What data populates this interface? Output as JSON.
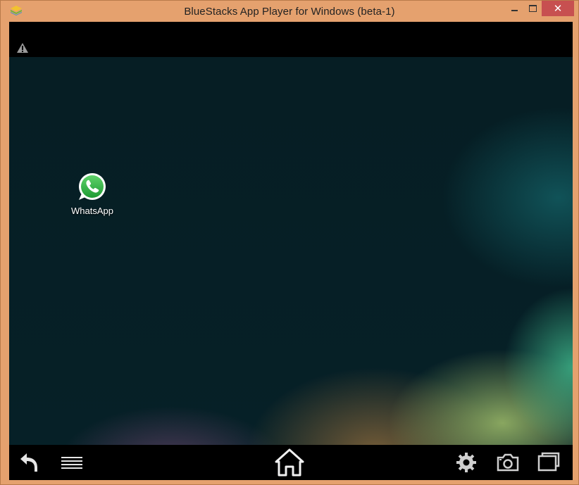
{
  "window": {
    "title": "BlueStacks App Player for Windows (beta-1)",
    "buttons": {
      "minimize": "minimize",
      "maximize": "maximize",
      "close": "✕"
    }
  },
  "statusbar": {
    "warning_icon": "warning-icon"
  },
  "home": {
    "apps": [
      {
        "label": "WhatsApp",
        "icon": "whatsapp-icon"
      }
    ]
  },
  "navbar": {
    "icons": [
      "back-icon",
      "menu-icon",
      "home-icon",
      "settings-icon",
      "camera-icon",
      "fullscreen-icon"
    ]
  },
  "colors": {
    "window_frame": "#e5a16e",
    "close_button": "#c75050",
    "wallpaper_base": "#062027",
    "whatsapp_green": "#2fb543"
  }
}
